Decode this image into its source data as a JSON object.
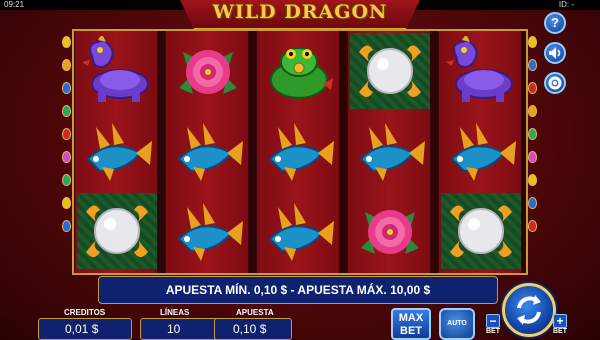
{
  "status": {
    "time": "09:21",
    "id_label": "ID: -"
  },
  "header": {
    "title": "WILD DRAGON"
  },
  "reels": [
    [
      "dragon-turtle",
      "koi-fish",
      "pearl"
    ],
    [
      "peony-flower",
      "koi-fish",
      "koi-fish"
    ],
    [
      "golden-toad",
      "koi-fish",
      "koi-fish"
    ],
    [
      "pearl",
      "koi-fish",
      "peony-flower"
    ],
    [
      "dragon-turtle",
      "koi-fish",
      "pearl"
    ]
  ],
  "info": {
    "message": "APUESTA MÍN. 0,10 $ - APUESTA MÁX. 10,00 $"
  },
  "fields": {
    "credits_label": "CREDITOS",
    "credits_value": "0,01 $",
    "lines_label": "LÍNEAS",
    "lines_value": "10",
    "bet_label": "APUESTA",
    "bet_value": "0,10 $"
  },
  "controls": {
    "max_bet_line1": "MAX",
    "max_bet_line2": "BET",
    "auto_label": "AUTO",
    "bet_minus_label": "BET",
    "bet_plus_label": "BET",
    "help_glyph": "?"
  },
  "colors": {
    "background": "#5a0a0c",
    "gold": "#c79a3c",
    "panel_blue": "#0e2270",
    "button_blue": "#1a4fbf"
  }
}
